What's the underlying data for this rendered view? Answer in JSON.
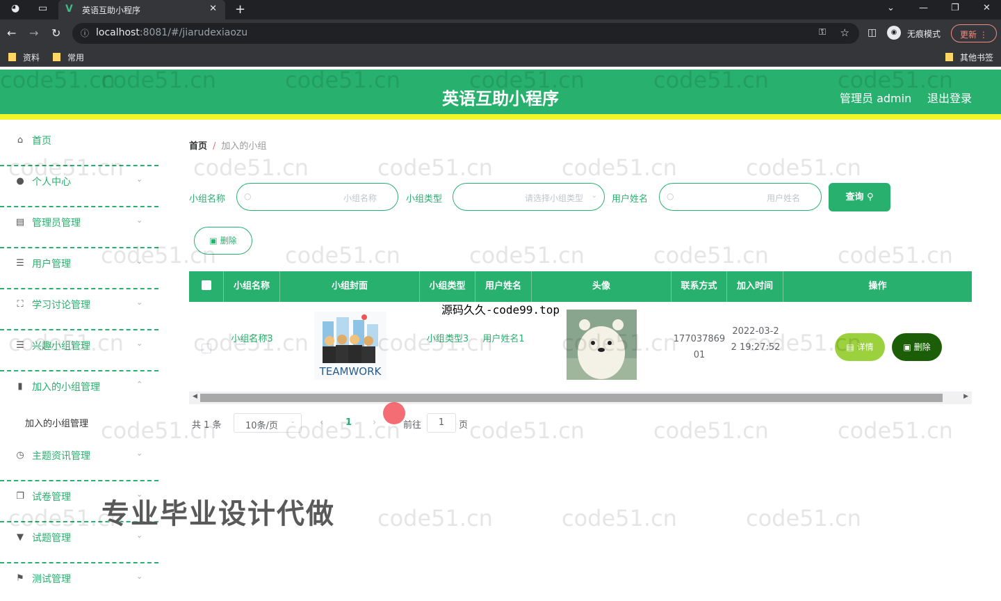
{
  "browser": {
    "tab_title": "英语互助小程序",
    "url_host": "localhost",
    "url_rest": ":8081/#/jiarudexiaozu",
    "incognito_label": "无痕模式",
    "update_label": "更新",
    "bookmarks": [
      "资料",
      "常用"
    ],
    "other_bookmarks": "其他书签"
  },
  "header": {
    "title": "英语互助小程序",
    "admin": "管理员 admin",
    "logout": "退出登录"
  },
  "sidebar": {
    "items": [
      {
        "label": "首页",
        "icon": "home-icon"
      },
      {
        "label": "个人中心",
        "icon": "user-icon"
      },
      {
        "label": "管理员管理",
        "icon": "admin-icon"
      },
      {
        "label": "用户管理",
        "icon": "list-icon"
      },
      {
        "label": "学习讨论管理",
        "icon": "expand-icon"
      },
      {
        "label": "兴趣小组管理",
        "icon": "list-icon"
      },
      {
        "label": "加入的小组管理",
        "icon": "chart-icon"
      },
      {
        "label": "主题资讯管理",
        "icon": "clock-icon"
      },
      {
        "label": "试卷管理",
        "icon": "copy-icon"
      },
      {
        "label": "试题管理",
        "icon": "trophy-icon"
      },
      {
        "label": "测试管理",
        "icon": "flag-icon"
      }
    ],
    "active_sub": "加入的小组管理"
  },
  "breadcrumb": {
    "home": "首页",
    "separator": "/",
    "current": "加入的小组"
  },
  "filters": {
    "group_name_label": "小组名称",
    "group_name_placeholder": "小组名称",
    "group_type_label": "小组类型",
    "group_type_placeholder": "请选择小组类型",
    "user_name_label": "用户姓名",
    "user_name_placeholder": "用户姓名",
    "query_label": "查询"
  },
  "toolbar": {
    "delete_label": "删除"
  },
  "table": {
    "columns": [
      "小组名称",
      "小组封面",
      "小组类型",
      "用户姓名",
      "头像",
      "联系方式",
      "加入时间",
      "操作"
    ],
    "rows": [
      {
        "group_name": "小组名称3",
        "cover_text": "TEAMWORK",
        "group_type": "小组类型3",
        "user_name": "用户姓名1",
        "contact": "17703786901",
        "join_time": "2022-03-22 19:27:52",
        "detail_label": "详情",
        "delete_label": "删除"
      }
    ]
  },
  "pagination": {
    "total": "共 1 条",
    "page_size": "10条/页",
    "current": "1",
    "goto_prefix": "前往",
    "goto_value": "1",
    "goto_suffix": "页"
  },
  "overlay": {
    "watermark": "code51.cn",
    "notice": "源码久久-code99.top",
    "banner": "专业毕业设计代做"
  },
  "colors": {
    "primary": "#28b06e",
    "accent_bar": "#f2f52a",
    "detail": "#9bd13c",
    "delete": "#1c5e08"
  }
}
